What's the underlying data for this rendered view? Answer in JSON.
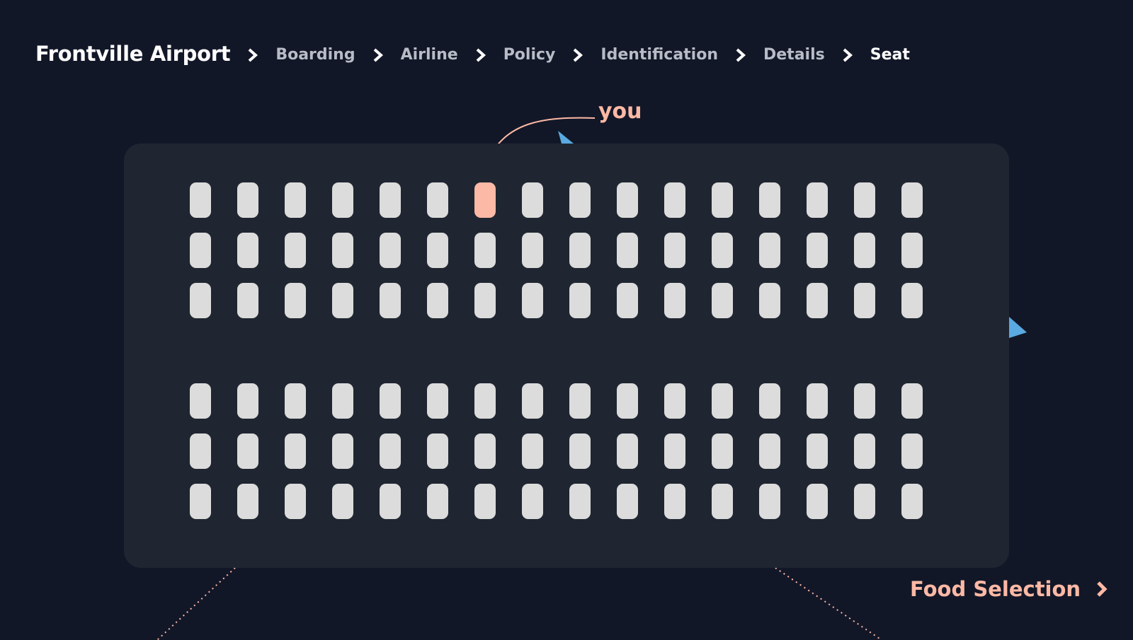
{
  "header": {
    "app_title": "Frontville Airport",
    "steps": [
      "Boarding",
      "Airline",
      "Policy",
      "Identification",
      "Details",
      "Seat"
    ],
    "current_step": "Seat"
  },
  "seat_map": {
    "marker_label": "you",
    "rows": 6,
    "seats_per_row": 16,
    "selected_seat": {
      "row": 1,
      "seat": 7
    }
  },
  "footer": {
    "next_label": "Food Selection"
  },
  "colors": {
    "background": "#121728",
    "cabin": "#1f2631",
    "seat": "#dcdcdc",
    "accent": "#fcb9a5",
    "plane": "#5aa9e0",
    "breadcrumb_inactive": "#b7bcc6"
  },
  "icons": {
    "breadcrumb_separator": "chevron-right-icon",
    "next": "chevron-right-icon"
  }
}
